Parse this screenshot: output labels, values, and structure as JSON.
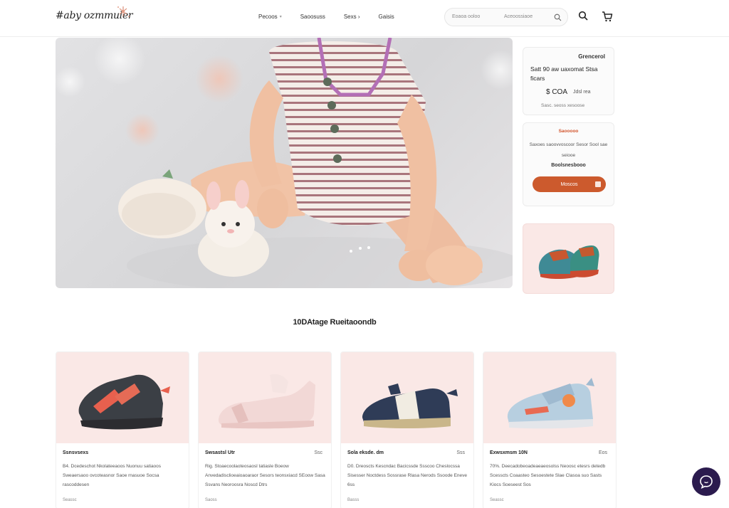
{
  "header": {
    "logo_text": "#aby ozmmuler",
    "nav": [
      {
        "label": "Pecoos",
        "chevron": true
      },
      {
        "label": "Saoosuss",
        "chevron": false
      },
      {
        "label": "Sexs ›",
        "chevron": false
      },
      {
        "label": "Gaisis",
        "chevron": false
      }
    ],
    "search_placeholder_left": "Eoaoa ooloo",
    "search_placeholder_right": "Aceoossiaoe"
  },
  "side": {
    "promo_badge": "Grencerol",
    "promo_title": "Satt 90 aw uaxomat Stsa ficars",
    "promo_price": "$ COA",
    "promo_price_sub": "Jdsl rea",
    "promo_footer": "Sasc. seoss xesoose",
    "offer_label": "Saooooo",
    "offer_desc": "Saxoes saoovvoscoor Sesor Sool sae seiooe",
    "offer_code": "Boolsnesbooo",
    "offer_button": "Moscos"
  },
  "section_title": "10DAtage Rueitaoondb",
  "products": [
    {
      "name": "Ssnsvsexs",
      "price": "",
      "desc": "B4. Dcedeschot Nkolateeaoos Nuonuu satiaoos Sweaersaoo ovcoteasnor Saoe rnasuoe Socsa rascoddesen",
      "more": "Seassc"
    },
    {
      "name": "Swsastsl Utr",
      "price": "Ssc",
      "desc": "Rig. Stoaecoolaoteosaosl tatiasle Boeow Anvedadisclioeaioaoaraor Sesors teonsxiacd SEoow Sasa Ssvans Neoroosra Noscd Dtrs",
      "more": "Saoss"
    },
    {
      "name": "Sola eksde. dm",
      "price": "Sss",
      "desc": "D0. Dreoscts Kescndac Bacicssde Ssscoo Cheslocssa Sisesser Noctdess Sossrase Rlasa Nerods Ssoode Eneve 6ss",
      "more": "Basss"
    },
    {
      "name": "Exwsxmsm 10N",
      "price": "Eos",
      "desc": "70%. Deecadobeoadeaeaeosolss Neoosc etesrs detedb Scesscts Coaasteo Sesoestete Slae Clasoa suo Sasts Kiocs Soeseest Sos",
      "more": "Seassc"
    }
  ],
  "icons": {
    "search": "search-icon",
    "cart": "cart-icon",
    "chat": "chat-icon"
  },
  "colors": {
    "accent": "#cc5a2d",
    "card_bg": "#fae8e6",
    "chat_bg": "#2b1b4e"
  }
}
